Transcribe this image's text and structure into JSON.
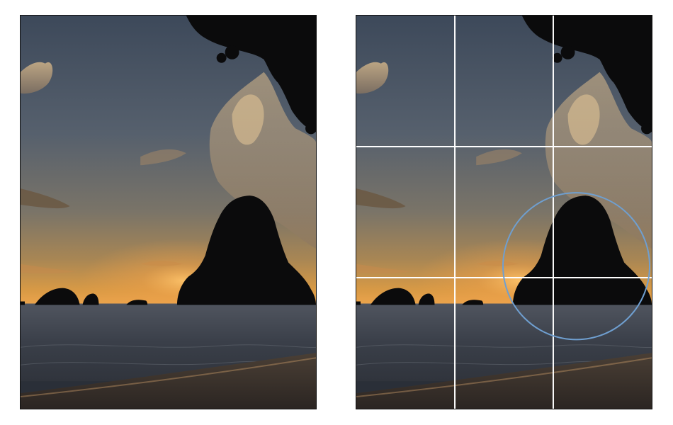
{
  "panels": [
    {
      "id": "original",
      "overlay": false
    },
    {
      "id": "rule-of-thirds",
      "overlay": true
    }
  ],
  "overlay": {
    "grid": "rule-of-thirds",
    "divisions": 3,
    "grid_color": "#ffffff",
    "highlight_color": "#6f9fd0",
    "highlight_subject": "rock-island"
  },
  "colors": {
    "sky_top": "#3f4c5e",
    "sky_mid": "#6f6f70",
    "horizon_glow": "#f2a34a",
    "sea": "#3b4250",
    "sand": "#3a3430",
    "silhouette": "#0b0b0c"
  }
}
